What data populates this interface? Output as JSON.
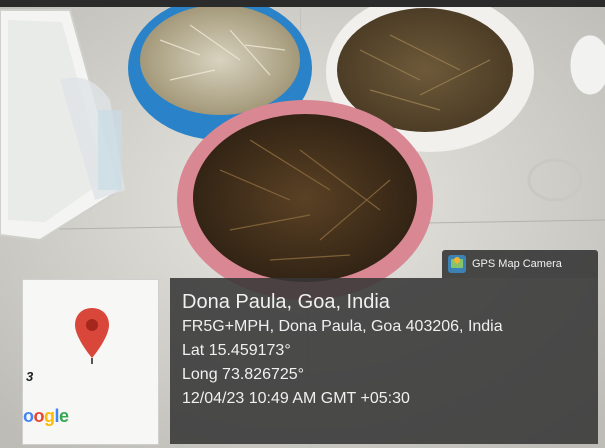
{
  "camera_badge": {
    "icon": "gps-map-camera-icon",
    "label": "GPS Map Camera"
  },
  "location": {
    "title": "Dona Paula, Goa, India",
    "address": "FR5G+MPH, Dona Paula, Goa 403206, India",
    "latitude": "Lat 15.459173°",
    "longitude": "Long 73.826725°",
    "timestamp": "12/04/23 10:49 AM GMT +05:30"
  },
  "map": {
    "pin_icon": "map-pin-icon",
    "pin_color": "#d9473a",
    "edge_number": "3",
    "logo_text": "Google"
  },
  "overlay_color": "#3a3a3a"
}
